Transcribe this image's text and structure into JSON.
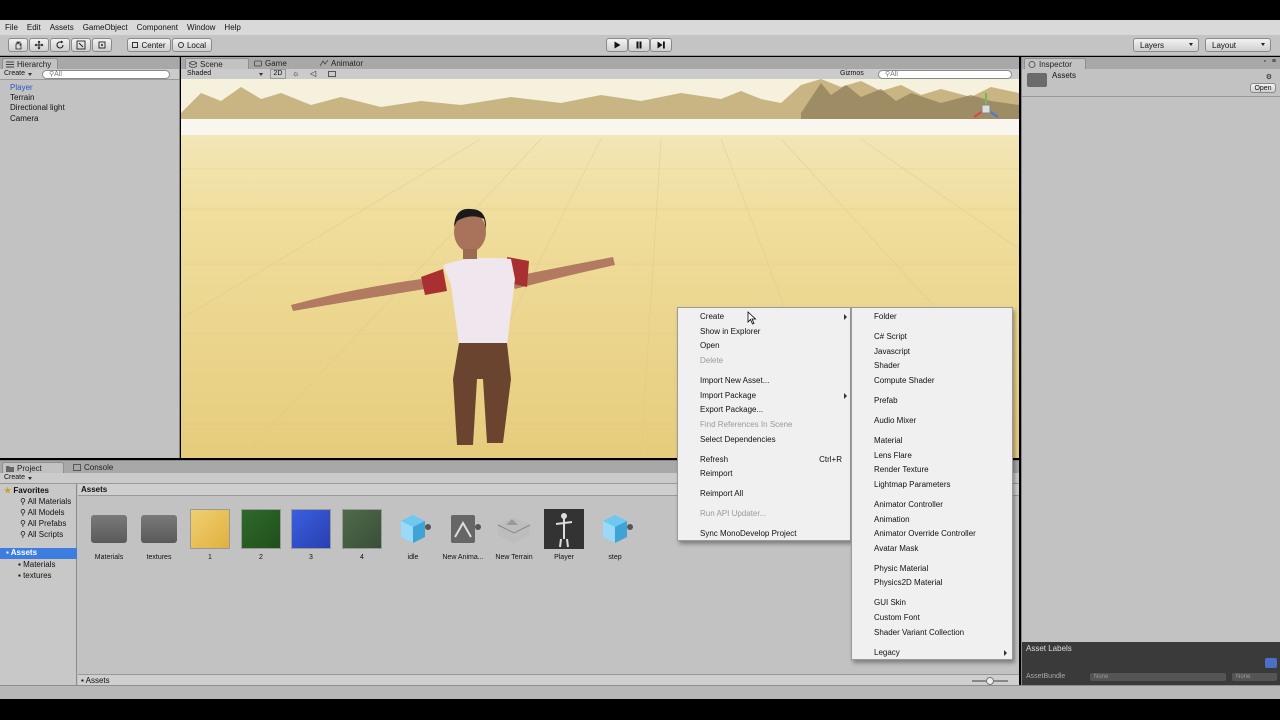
{
  "menubar": [
    "File",
    "Edit",
    "Assets",
    "GameObject",
    "Component",
    "Window",
    "Help"
  ],
  "toolbar": {
    "pivot": "Center",
    "space": "Local",
    "layers": "Layers",
    "layout": "Layout"
  },
  "hierarchy": {
    "tab": "Hierarchy",
    "create": "Create",
    "search_placeholder": "All",
    "items": [
      "Player",
      "Terrain",
      "Directional light",
      "Camera"
    ]
  },
  "scene": {
    "tabs": [
      "Scene",
      "Game",
      "Animator"
    ],
    "shading": "Shaded",
    "mode_2d": "2D",
    "gizmos": "Gizmos",
    "search_placeholder": "All"
  },
  "inspector": {
    "tab": "Inspector",
    "title": "Assets",
    "open": "Open",
    "asset_labels": "Asset Labels",
    "asset_bundle": "AssetBundle",
    "bundle_value": "None",
    "variant_value": "None"
  },
  "project": {
    "tabs": [
      "Project",
      "Console"
    ],
    "create": "Create",
    "favorites": "Favorites",
    "favorite_items": [
      "All Materials",
      "All Models",
      "All Prefabs",
      "All Scripts"
    ],
    "assets_root": "Assets",
    "asset_folders": [
      "Materials",
      "textures"
    ],
    "breadcrumb": "Assets",
    "footer_path": "Assets",
    "assets": [
      "Materials",
      "textures",
      "1",
      "2",
      "3",
      "4",
      "idle",
      "New Anima...",
      "New Terrain",
      "Player",
      "step"
    ]
  },
  "context_menu": {
    "items": [
      {
        "label": "Create",
        "submenu": true
      },
      {
        "label": "Show in Explorer"
      },
      {
        "label": "Open"
      },
      {
        "label": "Delete",
        "disabled": true
      },
      {
        "label": "Import New Asset..."
      },
      {
        "label": "Import Package",
        "submenu": true
      },
      {
        "label": "Export Package..."
      },
      {
        "label": "Find References In Scene",
        "disabled": true
      },
      {
        "label": "Select Dependencies"
      },
      {
        "label": "Refresh",
        "shortcut": "Ctrl+R"
      },
      {
        "label": "Reimport"
      },
      {
        "label": "Reimport All"
      },
      {
        "label": "Run API Updater...",
        "disabled": true
      },
      {
        "label": "Sync MonoDevelop Project"
      }
    ]
  },
  "create_submenu": {
    "items": [
      "Folder",
      "C# Script",
      "Javascript",
      "Shader",
      "Compute Shader",
      "Prefab",
      "Audio Mixer",
      "Material",
      "Lens Flare",
      "Render Texture",
      "Lightmap Parameters",
      "Animator Controller",
      "Animation",
      "Animator Override Controller",
      "Avatar Mask",
      "Physic Material",
      "Physics2D Material",
      "GUI Skin",
      "Custom Font",
      "Shader Variant Collection",
      "Legacy"
    ]
  },
  "colors": {
    "panel": "#c2c2c2",
    "selection": "#3e7de0",
    "menu_bg": "#f0f0f0"
  }
}
